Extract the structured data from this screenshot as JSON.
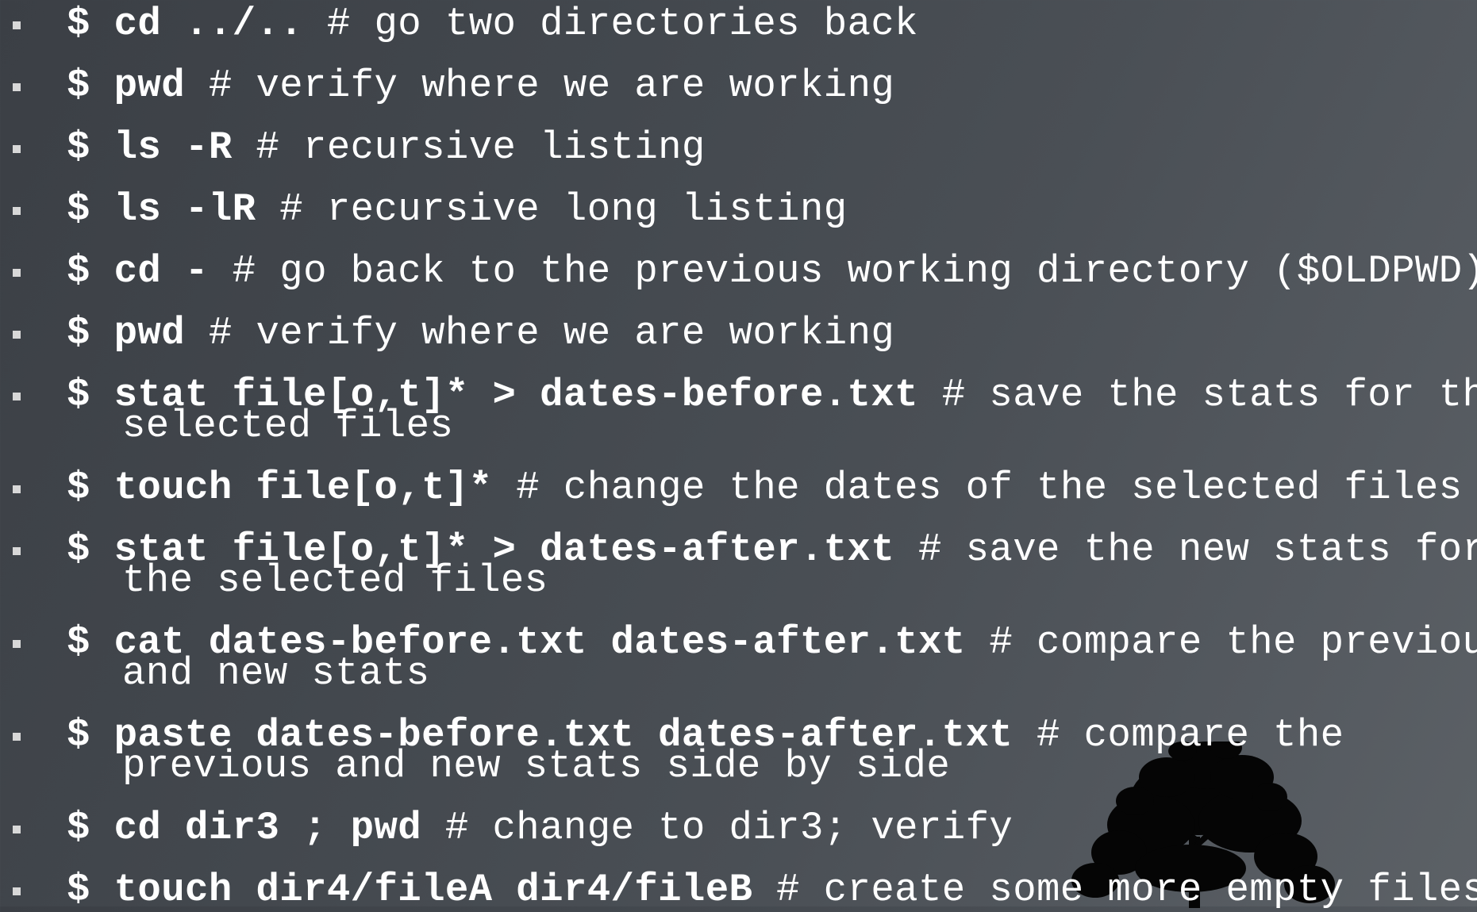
{
  "items": [
    {
      "cmd": "$ cd ../..",
      "comment": " # go two directories back",
      "cont": ""
    },
    {
      "cmd": "$ pwd",
      "comment": " # verify where we are working",
      "cont": ""
    },
    {
      "cmd": "$ ls -R",
      "comment": " # recursive listing",
      "cont": ""
    },
    {
      "cmd": "$ ls -lR",
      "comment": " # recursive long listing",
      "cont": ""
    },
    {
      "cmd": "$ cd -",
      "comment": " # go back to the previous working directory ($OLDPWD)",
      "cont": ""
    },
    {
      "cmd": "$ pwd",
      "comment": " # verify where we are working",
      "cont": ""
    },
    {
      "cmd": "$ stat file[o,t]* > dates-before.txt",
      "comment": " # save the stats for the",
      "cont": "selected files"
    },
    {
      "cmd": "$ touch file[o,t]*",
      "comment": " # change the dates of the selected files",
      "cont": ""
    },
    {
      "cmd": "$ stat file[o,t]* > dates-after.txt",
      "comment": " # save the new stats for",
      "cont": "the selected files"
    },
    {
      "cmd": "$ cat dates-before.txt dates-after.txt",
      "comment": " # compare the previous",
      "cont": "and new stats"
    },
    {
      "cmd": "$ paste dates-before.txt dates-after.txt",
      "comment": " # compare the",
      "cont": "previous and new stats side by side"
    },
    {
      "cmd": "$ cd dir3 ; pwd",
      "comment": " # change to dir3; verify",
      "cont": ""
    },
    {
      "cmd": "$ touch dir4/fileA dir4/fileB",
      "comment": " # create some more empty files",
      "cont": ""
    }
  ]
}
